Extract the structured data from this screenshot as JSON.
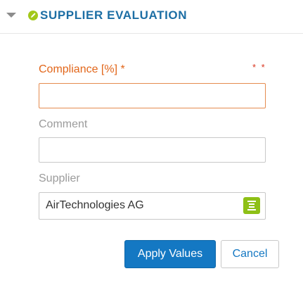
{
  "section": {
    "title": "SUPPLIER EVALUATION",
    "toggle_icon": "caret-down-icon",
    "status_icon": "pencil-circle-icon",
    "status_color": "#a3c81a",
    "title_color": "#1c6ea4"
  },
  "form": {
    "compliance": {
      "label": "Compliance [%] *",
      "value": "",
      "required_marker": "* *",
      "label_color": "#e2661a"
    },
    "comment": {
      "label": "Comment",
      "value": ""
    },
    "supplier": {
      "label": "Supplier",
      "value": "AirTechnologies AG",
      "picker_icon": "list-icon",
      "picker_color": "#8ec016"
    }
  },
  "actions": {
    "apply_label": "Apply Values",
    "cancel_label": "Cancel",
    "apply_color": "#1478c3"
  }
}
